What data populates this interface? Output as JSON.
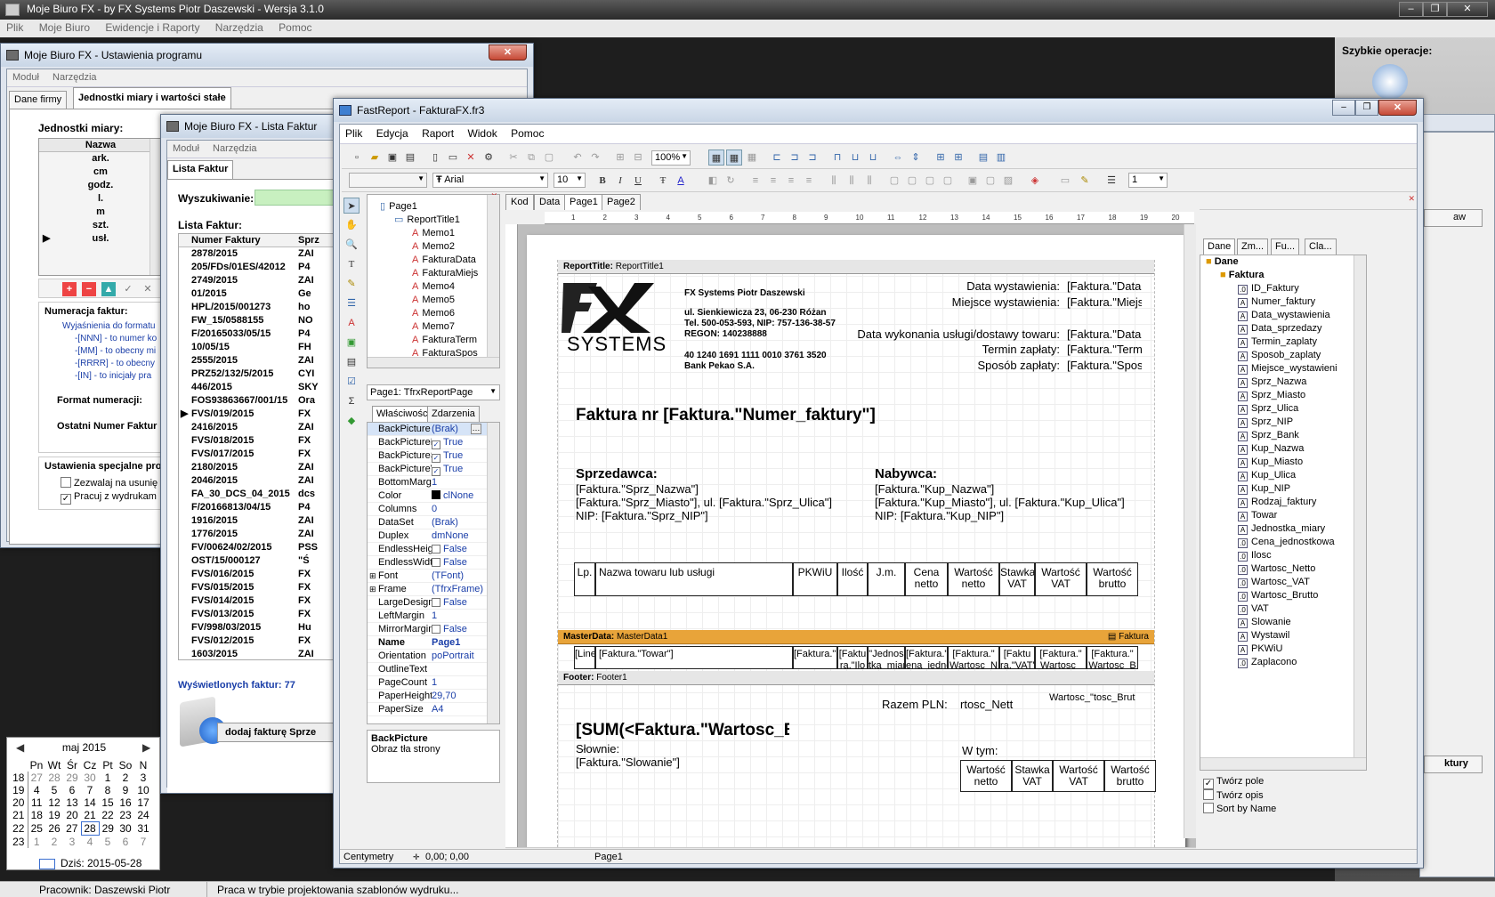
{
  "main_window": {
    "title": "Moje Biuro FX - by FX Systems Piotr Daszewski - Wersja 3.1.0",
    "menu": [
      "Plik",
      "Moje Biuro",
      "Ewidencje i Raporty",
      "Narzędzia",
      "Pomoc"
    ],
    "quick_ops_label": "Szybkie operacje:",
    "status_left": "Pracownik: Daszewski Piotr",
    "status_right": "Praca w trybie projektowania szablonów wydruku..."
  },
  "settings_window": {
    "title": "Moje Biuro FX - Ustawienia programu",
    "menu": [
      "Moduł",
      "Narzędzia"
    ],
    "tabs": [
      "Dane firmy",
      "Jednostki miary i wartości stałe"
    ],
    "units_label": "Jednostki miary:",
    "units_header": "Nazwa",
    "units": [
      "ark.",
      "cm",
      "godz.",
      "l.",
      "m",
      "szt.",
      "usł."
    ],
    "numbering_label": "Numeracja faktur:",
    "numbering_help": [
      "Wyjaśnienia do formatu",
      "-[NNN] - to numer ko",
      "-[MM] - to obecny mi",
      "-[RRRR] - to obecny",
      "-[IN] - to inicjały pra"
    ],
    "format_label": "Format numeracji:",
    "last_number_label": "Ostatni Numer Faktur",
    "special_label": "Ustawienia specjalne pro",
    "checkbox_allow": "Zezwalaj na usunię",
    "checkbox_print": "Pracuj z wydrukam"
  },
  "invoice_window": {
    "title": "Moje Biuro FX - Lista Faktur",
    "menu": [
      "Moduł",
      "Narzędzia"
    ],
    "tab": "Lista Faktur",
    "search_label": "Wyszukiwanie:",
    "list_label": "Lista Faktur:",
    "columns": [
      "Numer Faktury",
      "Sprz"
    ],
    "rows": [
      [
        "2878/2015",
        "ZAI"
      ],
      [
        "205/FDs/01ES/42012",
        "P4"
      ],
      [
        "2749/2015",
        "ZAI"
      ],
      [
        "01/2015",
        "Ge"
      ],
      [
        "HPL/2015/001273",
        "ho"
      ],
      [
        "FW_15/0588155",
        "NO"
      ],
      [
        "F/20165033/05/15",
        "P4"
      ],
      [
        "10/05/15",
        "FH"
      ],
      [
        "2555/2015",
        "ZAI"
      ],
      [
        "PRZ52/132/5/2015",
        "CYI"
      ],
      [
        "446/2015",
        "SKY"
      ],
      [
        "FOS93863667/001/15",
        "Ora"
      ],
      [
        "FVS/019/2015",
        "FX"
      ],
      [
        "2416/2015",
        "ZAI"
      ],
      [
        "FVS/018/2015",
        "FX"
      ],
      [
        "FVS/017/2015",
        "FX"
      ],
      [
        "2180/2015",
        "ZAI"
      ],
      [
        "2046/2015",
        "ZAI"
      ],
      [
        "FA_30_DCS_04_2015",
        "dcs"
      ],
      [
        "F/20166813/04/15",
        "P4"
      ],
      [
        "1916/2015",
        "ZAI"
      ],
      [
        "1776/2015",
        "ZAI"
      ],
      [
        "FV/00624/02/2015",
        "PSS"
      ],
      [
        "OST/15/000127",
        "\"Ś"
      ],
      [
        "FVS/016/2015",
        "FX"
      ],
      [
        "FVS/015/2015",
        "FX"
      ],
      [
        "FVS/014/2015",
        "FX"
      ],
      [
        "FVS/013/2015",
        "FX"
      ],
      [
        "FV/998/03/2015",
        "Hu"
      ],
      [
        "FVS/012/2015",
        "FX"
      ],
      [
        "1603/2015",
        "ZAI"
      ]
    ],
    "count_text": "Wyświetlonych faktur: 77",
    "add_button": "dodaj fakturę Sprze"
  },
  "calendar": {
    "month": "maj 2015",
    "weekdays": [
      "Pn",
      "Wt",
      "Śr",
      "Cz",
      "Pt",
      "So",
      "N"
    ],
    "weeks": [
      [
        "18",
        "27",
        "28",
        "29",
        "30",
        "1",
        "2",
        "3"
      ],
      [
        "19",
        "4",
        "5",
        "6",
        "7",
        "8",
        "9",
        "10"
      ],
      [
        "20",
        "11",
        "12",
        "13",
        "14",
        "15",
        "16",
        "17"
      ],
      [
        "21",
        "18",
        "19",
        "20",
        "21",
        "22",
        "23",
        "24"
      ],
      [
        "22",
        "25",
        "26",
        "27",
        "28",
        "29",
        "30",
        "31"
      ],
      [
        "23",
        "1",
        "2",
        "3",
        "4",
        "5",
        "6",
        "7"
      ]
    ],
    "today_label": "Dziś: 2015-05-28"
  },
  "fastreport": {
    "title": "FastReport - FakturaFX.fr3",
    "menu": [
      "Plik",
      "Edycja",
      "Raport",
      "Widok",
      "Pomoc"
    ],
    "zoom": "100%",
    "font_name": "Arial",
    "font_size": "10",
    "line_width": "1",
    "page_tabs": [
      "Kod",
      "Data",
      "Page1",
      "Page2"
    ],
    "tree": [
      "Page1",
      "ReportTitle1",
      "Memo1",
      "Memo2",
      "FakturaData",
      "FakturaMiejs",
      "Memo4",
      "Memo5",
      "Memo6",
      "Memo7",
      "FakturaTerm",
      "FakturaSpos"
    ],
    "object_selector": "Page1: TfrxReportPage",
    "inspector_tabs": [
      "Właściwości",
      "Zdarzenia"
    ],
    "properties": [
      [
        "BackPicture",
        "(Brak)"
      ],
      [
        "BackPictureP",
        "True"
      ],
      [
        "BackPictureS",
        "True"
      ],
      [
        "BackPictureVi",
        "True"
      ],
      [
        "BottomMargi",
        "1"
      ],
      [
        "Color",
        "clNone"
      ],
      [
        "Columns",
        "0"
      ],
      [
        "DataSet",
        "(Brak)"
      ],
      [
        "Duplex",
        "dmNone"
      ],
      [
        "EndlessHeigh",
        "False"
      ],
      [
        "EndlessWidth",
        "False"
      ],
      [
        "Font",
        "(TFont)"
      ],
      [
        "Frame",
        "(TfrxFrame)"
      ],
      [
        "LargeDesign",
        "False"
      ],
      [
        "LeftMargin",
        "1"
      ],
      [
        "MirrorMargin",
        "False"
      ],
      [
        "Name",
        "Page1"
      ],
      [
        "Orientation",
        "poPortrait"
      ],
      [
        "OutlineText",
        ""
      ],
      [
        "PageCount",
        "1"
      ],
      [
        "PaperHeight",
        "29,70"
      ],
      [
        "PaperSize",
        "A4"
      ]
    ],
    "help_title": "BackPicture",
    "help_text": "Obraz tła strony",
    "ruler_numbers": [
      "1",
      "2",
      "3",
      "4",
      "5",
      "6",
      "7",
      "8",
      "9",
      "10",
      "11",
      "12",
      "13",
      "14",
      "15",
      "16",
      "17",
      "18",
      "19",
      "20"
    ],
    "status_units": "Centymetry",
    "status_coords": "0,00; 0,00",
    "status_page": "Page1",
    "data_tabs": [
      "Dane",
      "Zm...",
      "Fu...",
      "Cla..."
    ],
    "data_root": "Dane",
    "dataset": "Faktura",
    "fields": [
      "ID_Faktury",
      "Numer_faktury",
      "Data_wystawienia",
      "Data_sprzedazy",
      "Termin_zaplaty",
      "Sposob_zaplaty",
      "Miejsce_wystawieni",
      "Sprz_Nazwa",
      "Sprz_Miasto",
      "Sprz_Ulica",
      "Sprz_NIP",
      "Sprz_Bank",
      "Kup_Nazwa",
      "Kup_Miasto",
      "Kup_Ulica",
      "Kup_NIP",
      "Rodzaj_faktury",
      "Towar",
      "Jednostka_miary",
      "Cena_jednostkowa",
      "Ilosc",
      "Wartosc_Netto",
      "Wartosc_VAT",
      "Wartosc_Brutto",
      "VAT",
      "Slowanie",
      "Wystawil",
      "PKWiU",
      "Zaplacono"
    ],
    "opt_create_field": "Twórz pole",
    "opt_create_caption": "Twórz opis",
    "opt_sort": "Sort by Name",
    "report": {
      "band_title": "ReportTitle:",
      "band_title_name": "ReportTitle1",
      "band_master": "MasterData:",
      "band_master_name": "MasterData1",
      "band_master_ds": "Faktura",
      "band_footer": "Footer:",
      "band_footer_name": "Footer1",
      "logo_text": "SYSTEMS",
      "company_name": "FX Systems Piotr Daszewski",
      "company_addr": "ul. Sienkiewicza 23, 06-230 Różan",
      "company_tel": "Tel. 500-053-593, NIP: 757-136-38-57",
      "company_regon": "REGON: 140238888",
      "company_account": "40 1240 1691 1111 0010 3761 3520",
      "company_bank": "Bank Pekao S.A.",
      "issue_date_label": "Data wystawienia:",
      "issue_date_val": "[Faktura.\"Data",
      "issue_place_label": "Miejsce wystawienia:",
      "issue_place_val": "[Faktura.\"Miejs",
      "service_date_label": "Data wykonania usługi/dostawy towaru:",
      "service_date_val": "[Faktura.\"Data",
      "payment_term_label": "Termin zapłaty:",
      "payment_term_val": "[Faktura.\"Term",
      "payment_method_label": "Sposób zapłaty:",
      "payment_method_val": "[Faktura.\"Spos",
      "invoice_title": "Faktura nr [Faktura.\"Numer_faktury\"]",
      "seller_label": "Sprzedawca:",
      "seller_lines": [
        "[Faktura.\"Sprz_Nazwa\"]",
        "[Faktura.\"Sprz_Miasto\"], ul. [Faktura.\"Sprz_Ulica\"]",
        "NIP: [Faktura.\"Sprz_NIP\"]"
      ],
      "buyer_label": "Nabywca:",
      "buyer_lines": [
        "[Faktura.\"Kup_Nazwa\"]",
        "[Faktura.\"Kup_Miasto\"], ul. [Faktura.\"Kup_Ulica\"]",
        "NIP: [Faktura.\"Kup_NIP\"]"
      ],
      "table_headers": [
        "Lp.",
        "Nazwa towaru lub usługi",
        "PKWiU",
        "Ilość",
        "J.m.",
        "Cena netto",
        "Wartość netto",
        "Stawka VAT",
        "Wartość VAT",
        "Wartość brutto"
      ],
      "data_cells": [
        "[Line]",
        "[Faktura.\"Towar\"]",
        "[Faktura.\"PKWiU",
        "[Faktu ra.\"Ilo",
        "\"Jednos tka_miar",
        "[Faktura.\"C ena_jedno",
        "[Faktura.\" Wartosc_N",
        "[Faktu ra.\"VAT\"",
        "[Faktura.\" Wartosc_",
        "[Faktura.\" Wartosc_B"
      ],
      "total_label": "Razem PLN:",
      "total_val": "rtosc_Nett",
      "total_right": "Wartosc_\"tosc_Brut",
      "sum_text": "[SUM(<Faktura.\"Wartosc_Br",
      "words_label": "Słownie:",
      "words_val": "[Faktura.\"Slowanie\"]",
      "wtym_label": "W tym:",
      "footer_headers": [
        "Wartość netto",
        "Stawka VAT",
        "Wartość VAT",
        "Wartość brutto"
      ]
    }
  },
  "colors": {
    "master_band": "#e8a43a",
    "window_border": "#5f7087",
    "link_blue": "#1a3ea8"
  }
}
